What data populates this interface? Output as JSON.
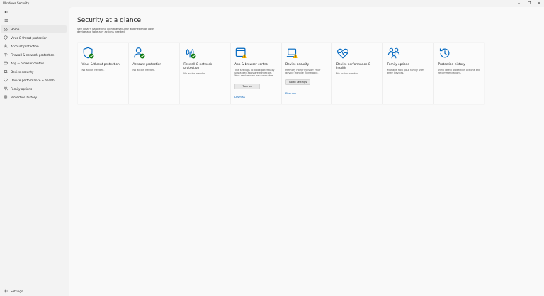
{
  "window": {
    "title": "Windows Security",
    "minimize_glyph": "–",
    "maximize_glyph": "❐",
    "close_glyph": "✕"
  },
  "sidebar": {
    "back_icon": "back-arrow-icon",
    "menu_icon": "hamburger-icon",
    "items": [
      {
        "label": "Home",
        "icon": "home-icon",
        "active": true
      },
      {
        "label": "Virus & threat protection",
        "icon": "shield-icon"
      },
      {
        "label": "Account protection",
        "icon": "person-icon"
      },
      {
        "label": "Firewall & network protection",
        "icon": "wifi-icon"
      },
      {
        "label": "App & browser control",
        "icon": "browser-window-icon"
      },
      {
        "label": "Device security",
        "icon": "laptop-icon"
      },
      {
        "label": "Device performance & health",
        "icon": "heart-icon"
      },
      {
        "label": "Family options",
        "icon": "family-icon"
      },
      {
        "label": "Protection history",
        "icon": "history-icon"
      }
    ],
    "settings_label": "Settings"
  },
  "main": {
    "title": "Security at a glance",
    "subtitle": "See what's happening with the security and health of your device and take any actions needed.",
    "cards": [
      {
        "title": "Virus & threat protection",
        "desc": "No action needed.",
        "icon": "shield-check-icon",
        "status": "ok"
      },
      {
        "title": "Account protection",
        "desc": "No action needed.",
        "icon": "person-check-icon",
        "status": "ok"
      },
      {
        "title": "Firewall & network protection",
        "desc": "No action needed.",
        "icon": "wifi-check-icon",
        "status": "ok"
      },
      {
        "title": "App & browser control",
        "desc": "The settings to block potentially unwanted apps are turned off. Your device may be vulnerable.",
        "icon": "browser-warning-icon",
        "status": "warning",
        "button": "Turn on",
        "link": "Dismiss"
      },
      {
        "title": "Device security",
        "desc": "Memory integrity is off. Your device may be vulnerable.",
        "icon": "laptop-warning-icon",
        "status": "warning",
        "button": "Go to settings",
        "link": "Dismiss"
      },
      {
        "title": "Device performance & health",
        "desc": "No action needed.",
        "icon": "heart-pulse-icon",
        "status": "ok"
      },
      {
        "title": "Family options",
        "desc": "Manage how your family uses their devices.",
        "icon": "family-icon",
        "status": "info"
      },
      {
        "title": "Protection history",
        "desc": "View latest protection actions and recommendations.",
        "icon": "history-icon",
        "status": "info"
      }
    ]
  },
  "colors": {
    "accent": "#005fb8",
    "ok": "#107c10",
    "warning": "#f7b500",
    "icon_blue": "#0067c0"
  }
}
